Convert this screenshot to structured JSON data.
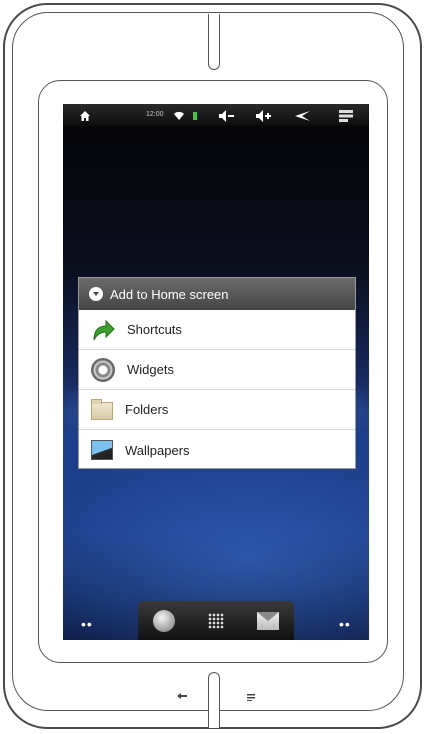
{
  "statusbar": {
    "time": "12:00",
    "icons": [
      "home-icon",
      "wifi-icon",
      "battery-icon",
      "volume-down-icon",
      "volume-up-icon",
      "back-icon",
      "menu-icon"
    ],
    "battery_color": "#2ecc40"
  },
  "dialog": {
    "title": "Add to Home screen",
    "items": [
      {
        "label": "Shortcuts",
        "icon": "shortcut-arrow-icon"
      },
      {
        "label": "Widgets",
        "icon": "widget-gear-icon"
      },
      {
        "label": "Folders",
        "icon": "folder-icon"
      },
      {
        "label": "Wallpapers",
        "icon": "wallpaper-icon"
      }
    ]
  },
  "dock": {
    "items": [
      "browser-globe-icon",
      "app-drawer-grid-icon",
      "email-icon"
    ]
  },
  "page_dots": {
    "left": "••",
    "right": "••"
  },
  "device": {
    "hardware_buttons": [
      "back-icon",
      "menu-icon"
    ]
  }
}
